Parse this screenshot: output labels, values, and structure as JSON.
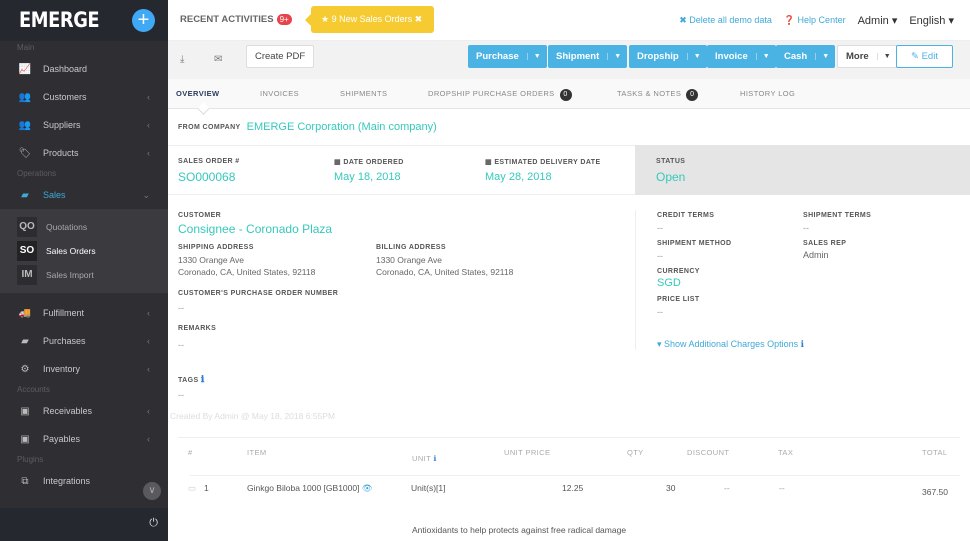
{
  "sidebar": {
    "logo": "EMERGE",
    "sections": {
      "main": "Main",
      "operations": "Operations",
      "accounts": "Accounts",
      "plugins": "Plugins"
    },
    "items": {
      "dashboard": "Dashboard",
      "customers": "Customers",
      "suppliers": "Suppliers",
      "products": "Products",
      "sales": "Sales",
      "fulfillment": "Fulfillment",
      "purchases": "Purchases",
      "inventory": "Inventory",
      "receivables": "Receivables",
      "payables": "Payables",
      "integrations": "Integrations"
    },
    "sales_sub": [
      {
        "abbr": "QO",
        "label": "Quotations"
      },
      {
        "abbr": "SO",
        "label": "Sales Orders"
      },
      {
        "abbr": "IM",
        "label": "Sales Import"
      }
    ]
  },
  "topbar": {
    "recent": "RECENT ACTIVITIES",
    "badge": "9+",
    "toast": "★ 9 New Sales Orders ✖",
    "delete_demo": "✖ Delete all demo data",
    "help": "❓ Help Center",
    "user": "Admin ▾",
    "language": "English ▾"
  },
  "toolbar": {
    "create_pdf": "Create PDF",
    "buttons": [
      "Purchase",
      "Shipment",
      "Dropship",
      "Invoice",
      "Cash",
      "More"
    ],
    "edit": "✎  Edit"
  },
  "tabs": [
    {
      "label": "OVERVIEW"
    },
    {
      "label": "INVOICES"
    },
    {
      "label": "SHIPMENTS"
    },
    {
      "label": "DROPSHIP PURCHASE ORDERS",
      "count": "0"
    },
    {
      "label": "TASKS & NOTES",
      "count": "0"
    },
    {
      "label": "HISTORY LOG"
    }
  ],
  "order": {
    "from_company_label": "FROM COMPANY",
    "from_company": "EMERGE Corporation (Main company)",
    "so_label": "SALES ORDER #",
    "so_number": "SO000068",
    "date_ordered_label": "DATE ORDERED",
    "date_ordered": "May 18, 2018",
    "delivery_label": "ESTIMATED DELIVERY DATE",
    "delivery_date": "May 28, 2018",
    "status_label": "STATUS",
    "status": "Open",
    "customer_label": "CUSTOMER",
    "customer": "Consignee - Coronado Plaza",
    "shipping_label": "SHIPPING ADDRESS",
    "shipping_line1": "1330 Orange Ave",
    "shipping_line2": "Coronado, CA, United States, 92118",
    "billing_label": "BILLING ADDRESS",
    "billing_line1": "1330 Orange Ave",
    "billing_line2": "Coronado, CA, United States, 92118",
    "cpo_label": "CUSTOMER'S PURCHASE ORDER NUMBER",
    "cpo": "--",
    "remarks_label": "REMARKS",
    "remarks": "--",
    "tags_label": "TAGS",
    "tags": "--",
    "credit_terms_label": "CREDIT TERMS",
    "credit_terms": "--",
    "shipment_terms_label": "SHIPMENT TERMS",
    "shipment_terms": "--",
    "shipment_method_label": "SHIPMENT METHOD",
    "shipment_method": "--",
    "sales_rep_label": "SALES REP",
    "sales_rep": "Admin",
    "currency_label": "CURRENCY",
    "currency": "SGD",
    "price_list_label": "PRICE LIST",
    "price_list": "--",
    "additional_charges": "▾ Show Additional Charges Options",
    "created": "Created By Admin @ May 18, 2018 6:55PM"
  },
  "line_items": {
    "headers": [
      "#",
      "ITEM",
      "UNIT",
      "UNIT PRICE",
      "QTY",
      "DISCOUNT",
      "TAX",
      "TOTAL"
    ],
    "rows": [
      {
        "num": "1",
        "item": "Ginkgo Biloba 1000 [GB1000]",
        "unit": "Unit(s)[1]",
        "unit_price": "12.25",
        "qty": "30",
        "discount": "--",
        "tax": "--",
        "total": "367.50",
        "description": "Antioxidants to help protects against free radical damage"
      }
    ]
  }
}
